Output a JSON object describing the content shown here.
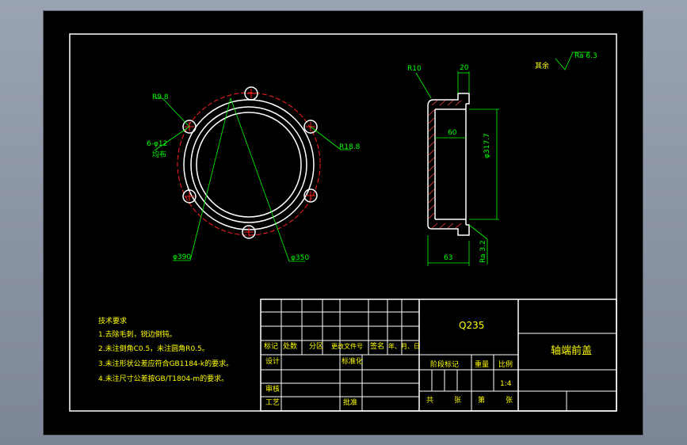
{
  "drawing": {
    "part_name": "轴端前盖",
    "material": "Q235",
    "scale": "1:4",
    "roughness_note": {
      "label": "其余",
      "value": "Ra 6.3"
    }
  },
  "dimensions": {
    "r_top": "R9.8",
    "holes": "6-φ12",
    "holes_sub": "均布",
    "r_right": "R18.8",
    "dia_outer": "φ390",
    "dia_inner": "φ350",
    "r10": "R10",
    "w20": "20",
    "w60": "60",
    "d317": "φ317.7",
    "w63": "63",
    "ra32": "Ra 3.2"
  },
  "tech_notes": {
    "title": "技术要求",
    "items": [
      "1.去除毛刺，锐边倒钝。",
      "2.未注倒角C0.5，未注圆角R0.5。",
      "3.未注形状公差应符合GB1184-k的要求。",
      "4.未注尺寸公差按GB/T1804-m的要求。"
    ]
  },
  "title_block": {
    "rev_headers": [
      "标记",
      "处数",
      "分区",
      "更改文件号",
      "签名",
      "年、月、日"
    ],
    "design": "设计",
    "standardize": "标准化",
    "review": "审核",
    "process": "工艺",
    "approve": "批准",
    "stage_mark": "阶段标记",
    "weight": "重量",
    "scale_label": "比例",
    "total": "共",
    "sheets": "张",
    "page": "第",
    "sheets2": "张"
  }
}
